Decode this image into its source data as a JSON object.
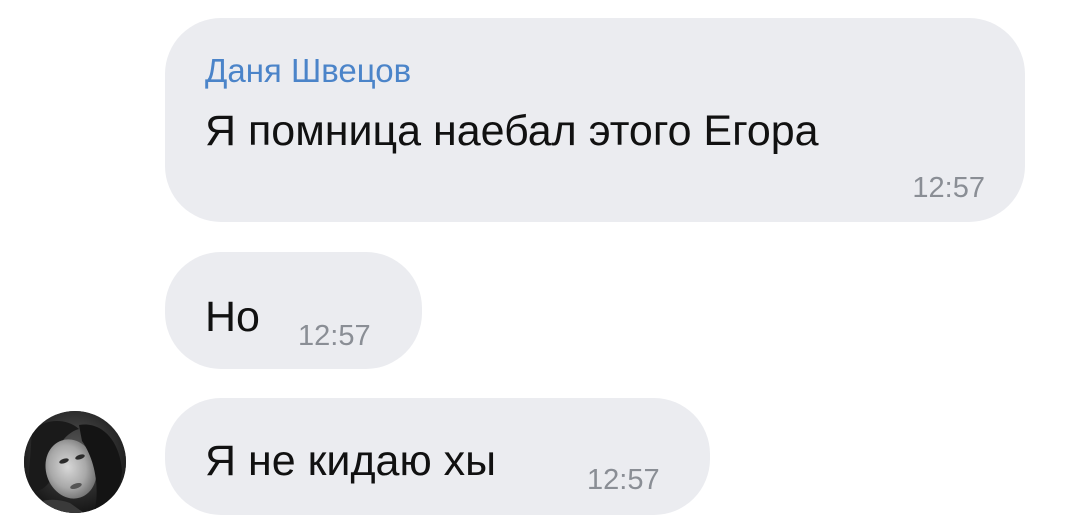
{
  "messages": [
    {
      "sender": "Даня Швецов",
      "text": "Я помница наебал этого Егора",
      "time": "12:57"
    },
    {
      "text": "Но",
      "time": "12:57"
    },
    {
      "text": "Я не кидаю хы",
      "time": "12:57"
    }
  ],
  "avatar": {
    "icon": "user-photo-avatar"
  },
  "colors": {
    "bubble": "#ebecf0",
    "sender_name": "#4b84c9",
    "text": "#111111",
    "time": "#8a8e95"
  }
}
